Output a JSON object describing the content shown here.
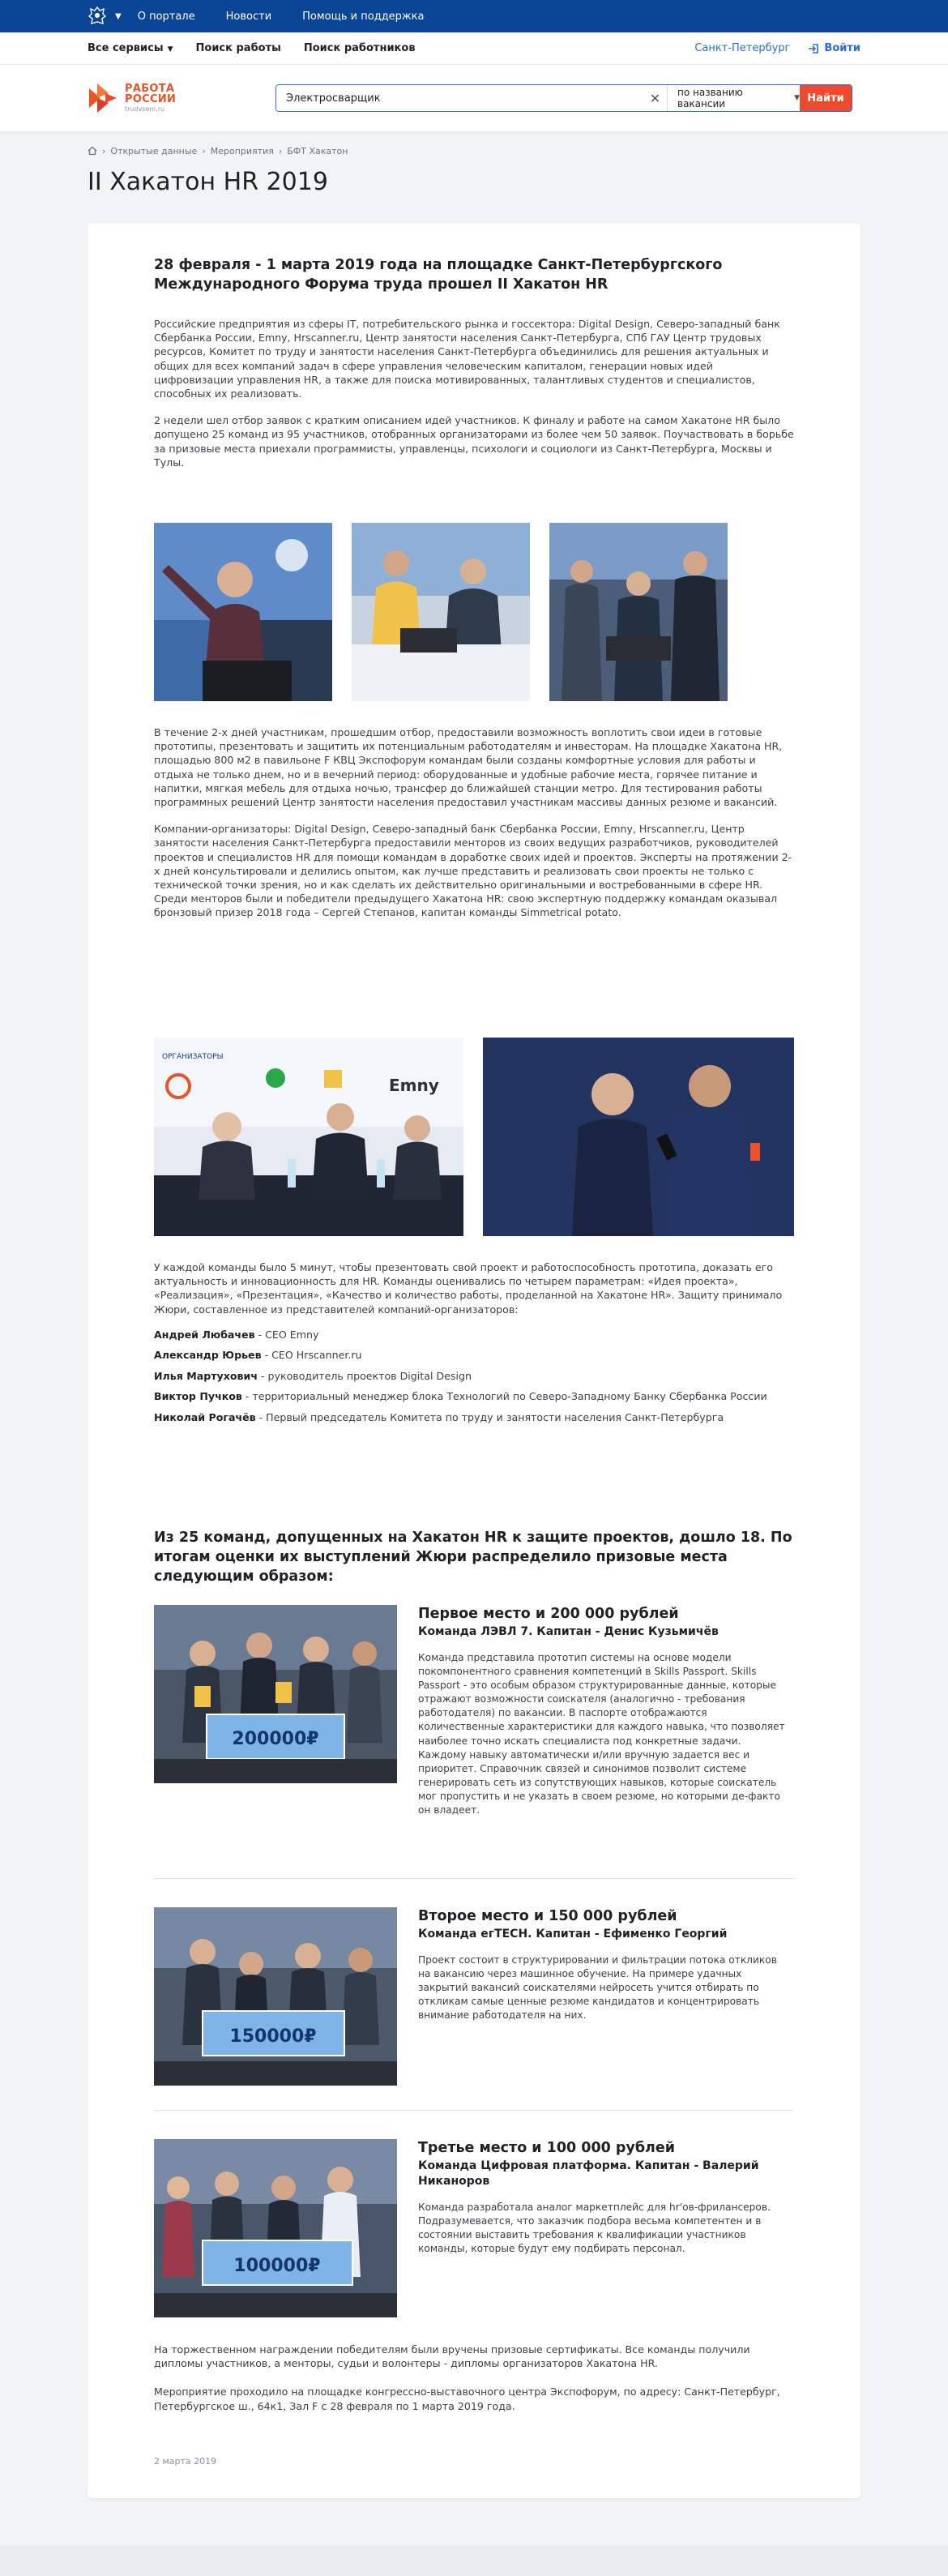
{
  "topnav": {
    "items": [
      "О портале",
      "Новости",
      "Помощь и поддержка"
    ]
  },
  "servicebar": {
    "all_services": "Все сервисы",
    "find_job": "Поиск работы",
    "find_workers": "Поиск работников",
    "city": "Санкт-Петербург",
    "login": "Войти"
  },
  "logo": {
    "line1": "РАБОТА",
    "line2": "РОССИИ",
    "line3": "trudvsem.ru"
  },
  "search": {
    "value": "Электросварщик",
    "mode": "по названию вакансии",
    "button": "Найти"
  },
  "breadcrumbs": [
    "Открытые данные",
    "Мероприятия",
    "БФТ Хакатон"
  ],
  "page_title": "II Хакатон HR 2019",
  "article": {
    "lead": "28 февраля - 1 марта 2019 года на площадке Санкт-Петербургского Международного Форума труда прошел II Хакатон HR",
    "intro_p1": "Российские предприятия из сферы IT, потребительского рынка и госсектора: Digital Design, Северо-западный банк Сбербанка России, Emny, Hrscanner.ru, Центр занятости населения Санкт-Петербурга, СПб ГАУ Центр трудовых ресурсов, Комитет по труду и занятости населения Санкт-Петербурга объединились для решения актуальных и общих для всех компаний задач в сфере управления человеческим капиталом, генерации новых идей цифровизации управления HR, а также для поиска мотивированных, талантливых студентов и специалистов, способных их реализовать.",
    "intro_p2": "2 недели шел отбор заявок с кратким описанием идей участников. К финалу и работе на самом Хакатоне HR было допущено 25 команд из 95 участников, отобранных организаторами из более чем 50 заявок. Поучаствовать в борьбе за призовые места приехали программисты, управленцы, психологи и социологи из Санкт-Петербурга, Москвы и Тулы.",
    "body_p1": "В течение 2-х дней участникам, прошедшим отбор, предоставили возможность воплотить свои идеи в готовые прототипы, презентовать и защитить их потенциальным работодателям и инвесторам. На площадке Хакатона HR, площадью 800 м2 в павильоне F КВЦ Экспофорум командам были созданы комфортные условия для работы и отдыха не только днем, но и в вечерний период: оборудованные и удобные рабочие места, горячее питание и напитки, мягкая мебель для отдыха ночью, трансфер до ближайшей станции метро. Для тестирования работы программных решений Центр занятости населения предоставил участникам массивы данных резюме и вакансий.",
    "body_p2": "Компании-организаторы: Digital Design, Северо-западный банк Сбербанка России, Emny, Hrscanner.ru, Центр занятости населения Санкт-Петербурга предоставили менторов из своих ведущих разработчиков, руководителей проектов и специалистов HR для помощи командам в доработке своих идей и проектов. Эксперты на протяжении 2-х дней консультировали и делились опытом, как лучше представить и реализовать свои проекты не только с технической точки зрения, но и как сделать их действительно оригинальными и востребованными в сфере HR. Среди менторов были и победители предыдущего Хакатона HR: свою экспертную поддержку командам оказывал бронзовый призер 2018 года – Сергей Степанов, капитан команды Simmetrical potato.",
    "jury_p": "У каждой команды было 5 минут, чтобы презентовать свой проект и работоспособность прототипа, доказать его актуальность и инновационность для HR. Команды оценивались по четырем параметрам: «Идея проекта», «Реализация», «Презентация», «Качество и количество работы, проделанной на Хакатоне HR». Защиту принимало Жюри, составленное из представителей компаний-организаторов:",
    "jury": [
      {
        "name": "Андрей Любачев",
        "role": " - CEO Emny"
      },
      {
        "name": "Александр Юрьев",
        "role": " - CEO Hrscanner.ru"
      },
      {
        "name": "Илья Мартухович",
        "role": " - руководитель проектов Digital Design"
      },
      {
        "name": "Виктор Пучков",
        "role": " - территориальный менеджер блока Технологий по Северо-Западному Банку Сбербанка России"
      },
      {
        "name": "Николай Рогачёв",
        "role": " - Первый председатель Комитета по труду и занятости населения Санкт-Петербурга"
      }
    ],
    "results_lead": "Из 25 команд, допущенных на Хакатон HR к защите проектов, дошло 18. По итогам оценки их выступлений Жюри распределило призовые места следующим образом:",
    "prizes": [
      {
        "title": "Первое место и 200 000 рублей",
        "team": "Команда ЛЭВЛ 7. Капитан - Денис Кузьмичёв",
        "desc": "Команда представила прототип системы на основе модели покомпонентного сравнения компетенций в Skills Passport. Skills Passport - это особым образом структурированные данные, которые отражают возможности соискателя (аналогично - требования работодателя) по вакансии. В паспорте отображаются количественные характеристики для каждого навыка, что позволяет наиболее точно искать специалиста под конкретные задачи. Каждому навыку автоматически и/или вручную задается вес и приоритет. Справочник связей и синонимов позволит системе генерировать сеть из сопутствующих навыков, которые соискатель мог пропустить и не указать в своем резюме, но которыми де-факто он владеет.",
        "cheque": "200000₽"
      },
      {
        "title": "Второе место и 150 000 рублей",
        "team": "Команда егТЕСН. Капитан - Ефименко Георгий",
        "desc": "Проект состоит в структурировании и фильтрации потока откликов на вакансию через машинное обучение. На примере удачных закрытий вакансий соискателями нейросеть учится отбирать по откликам самые ценные резюме кандидатов и концентрировать внимание работодателя на них.",
        "cheque": "150000₽"
      },
      {
        "title": "Третье место и 100 000 рублей",
        "team": "Команда Цифровая платформа. Капитан - Валерий Никаноров",
        "desc": "Команда разработала аналог маркетплейс для hr'ов-фрилансеров. Подразумевается, что заказчик подбора весьма компетентен и в состоянии выставить требования к квалификации участников команды, которые будут ему подбирать персонал.",
        "cheque": "100000₽"
      }
    ],
    "closing_p1": "На торжественном награждении победителям были вручены призовые сертификаты. Все команды получили дипломы участников, а менторы, судьи и волонтеры - дипломы организаторов Хакатона HR.",
    "closing_p2": "Мероприятие проходило на площадке конгрессно-выставочного центра Экспофорум, по адресу: Санкт-Петербург, Петербургское ш., 64к1, Зал F с 28 февраля по 1 марта 2019 года.",
    "date": "2 марта 2019",
    "photo_banner_org": "ОРГАНИЗАТОРЫ",
    "photo_banner_emny": "Emny"
  },
  "colors": {
    "topbar": "#0a4596",
    "accent": "#ef4b2a",
    "link": "#2a6dd8"
  }
}
